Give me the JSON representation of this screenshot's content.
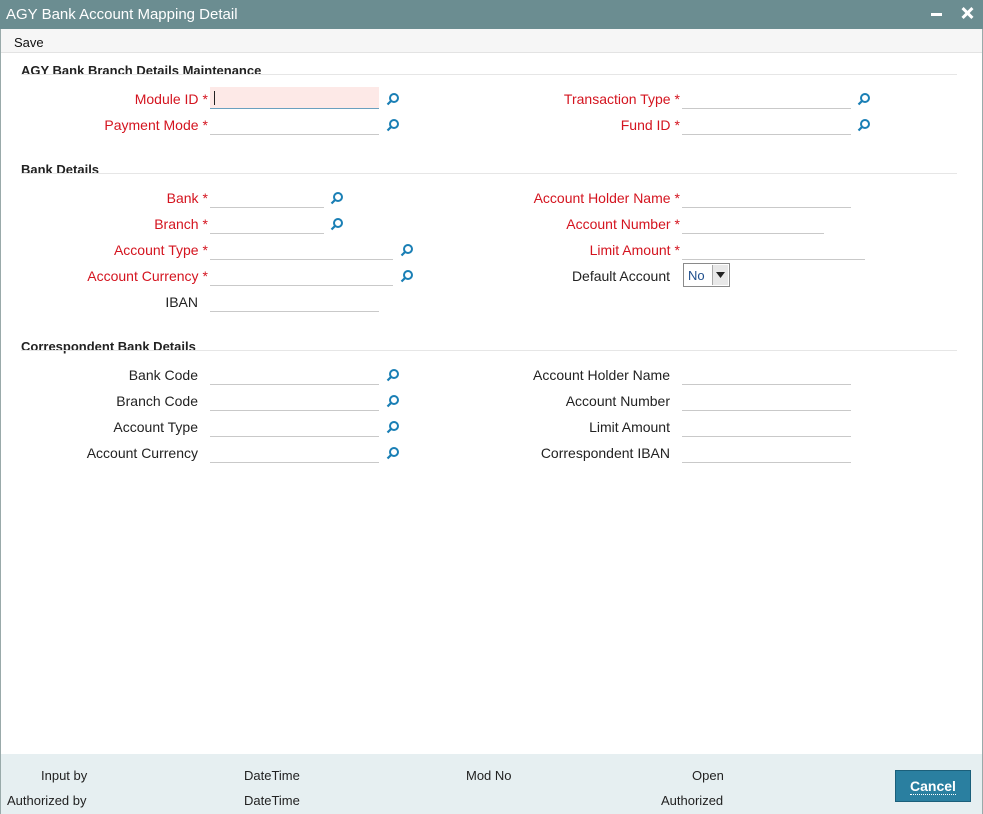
{
  "window": {
    "title": "AGY Bank Account Mapping Detail"
  },
  "menubar": {
    "save_label": "Save"
  },
  "sections": {
    "branch": "AGY Bank Branch Details Maintenance",
    "bank": "Bank Details",
    "correspondent": "Correspondent Bank Details"
  },
  "branch_fields": {
    "module_id": {
      "label": "Module ID",
      "value": ""
    },
    "payment_mode": {
      "label": "Payment Mode",
      "value": ""
    },
    "transaction_type": {
      "label": "Transaction Type",
      "value": ""
    },
    "fund_id": {
      "label": "Fund ID",
      "value": ""
    }
  },
  "bank_fields": {
    "bank": {
      "label": "Bank",
      "value": ""
    },
    "branch": {
      "label": "Branch",
      "value": ""
    },
    "account_type": {
      "label": "Account Type",
      "value": ""
    },
    "account_currency": {
      "label": "Account Currency",
      "value": ""
    },
    "iban": {
      "label": "IBAN",
      "value": ""
    },
    "account_holder_name": {
      "label": "Account Holder Name",
      "value": ""
    },
    "account_number": {
      "label": "Account Number",
      "value": ""
    },
    "limit_amount": {
      "label": "Limit Amount",
      "value": ""
    },
    "default_account": {
      "label": "Default Account",
      "value": "No"
    }
  },
  "correspondent_fields": {
    "bank_code": {
      "label": "Bank Code",
      "value": ""
    },
    "branch_code": {
      "label": "Branch Code",
      "value": ""
    },
    "account_type": {
      "label": "Account Type",
      "value": ""
    },
    "account_currency": {
      "label": "Account Currency",
      "value": ""
    },
    "account_holder_name": {
      "label": "Account Holder Name",
      "value": ""
    },
    "account_number": {
      "label": "Account Number",
      "value": ""
    },
    "limit_amount": {
      "label": "Limit Amount",
      "value": ""
    },
    "correspondent_iban": {
      "label": "Correspondent IBAN",
      "value": ""
    }
  },
  "required_marker": "*",
  "footer": {
    "input_by": "Input by",
    "authorized_by": "Authorized by",
    "datetime_1": "DateTime",
    "datetime_2": "DateTime",
    "mod_no": "Mod No",
    "open": "Open",
    "authorized": "Authorized",
    "cancel_label": "Cancel"
  },
  "colors": {
    "titlebar": "#6b8d91",
    "required_label": "#d4141f",
    "search_icon": "#1a7fb5",
    "footer_bg": "#e6eff1",
    "cancel_button": "#2a7fa0"
  },
  "icons": {
    "search": "search-icon",
    "close": "close-icon",
    "minimize": "minimize-icon",
    "dropdown": "chevron-down-icon"
  }
}
